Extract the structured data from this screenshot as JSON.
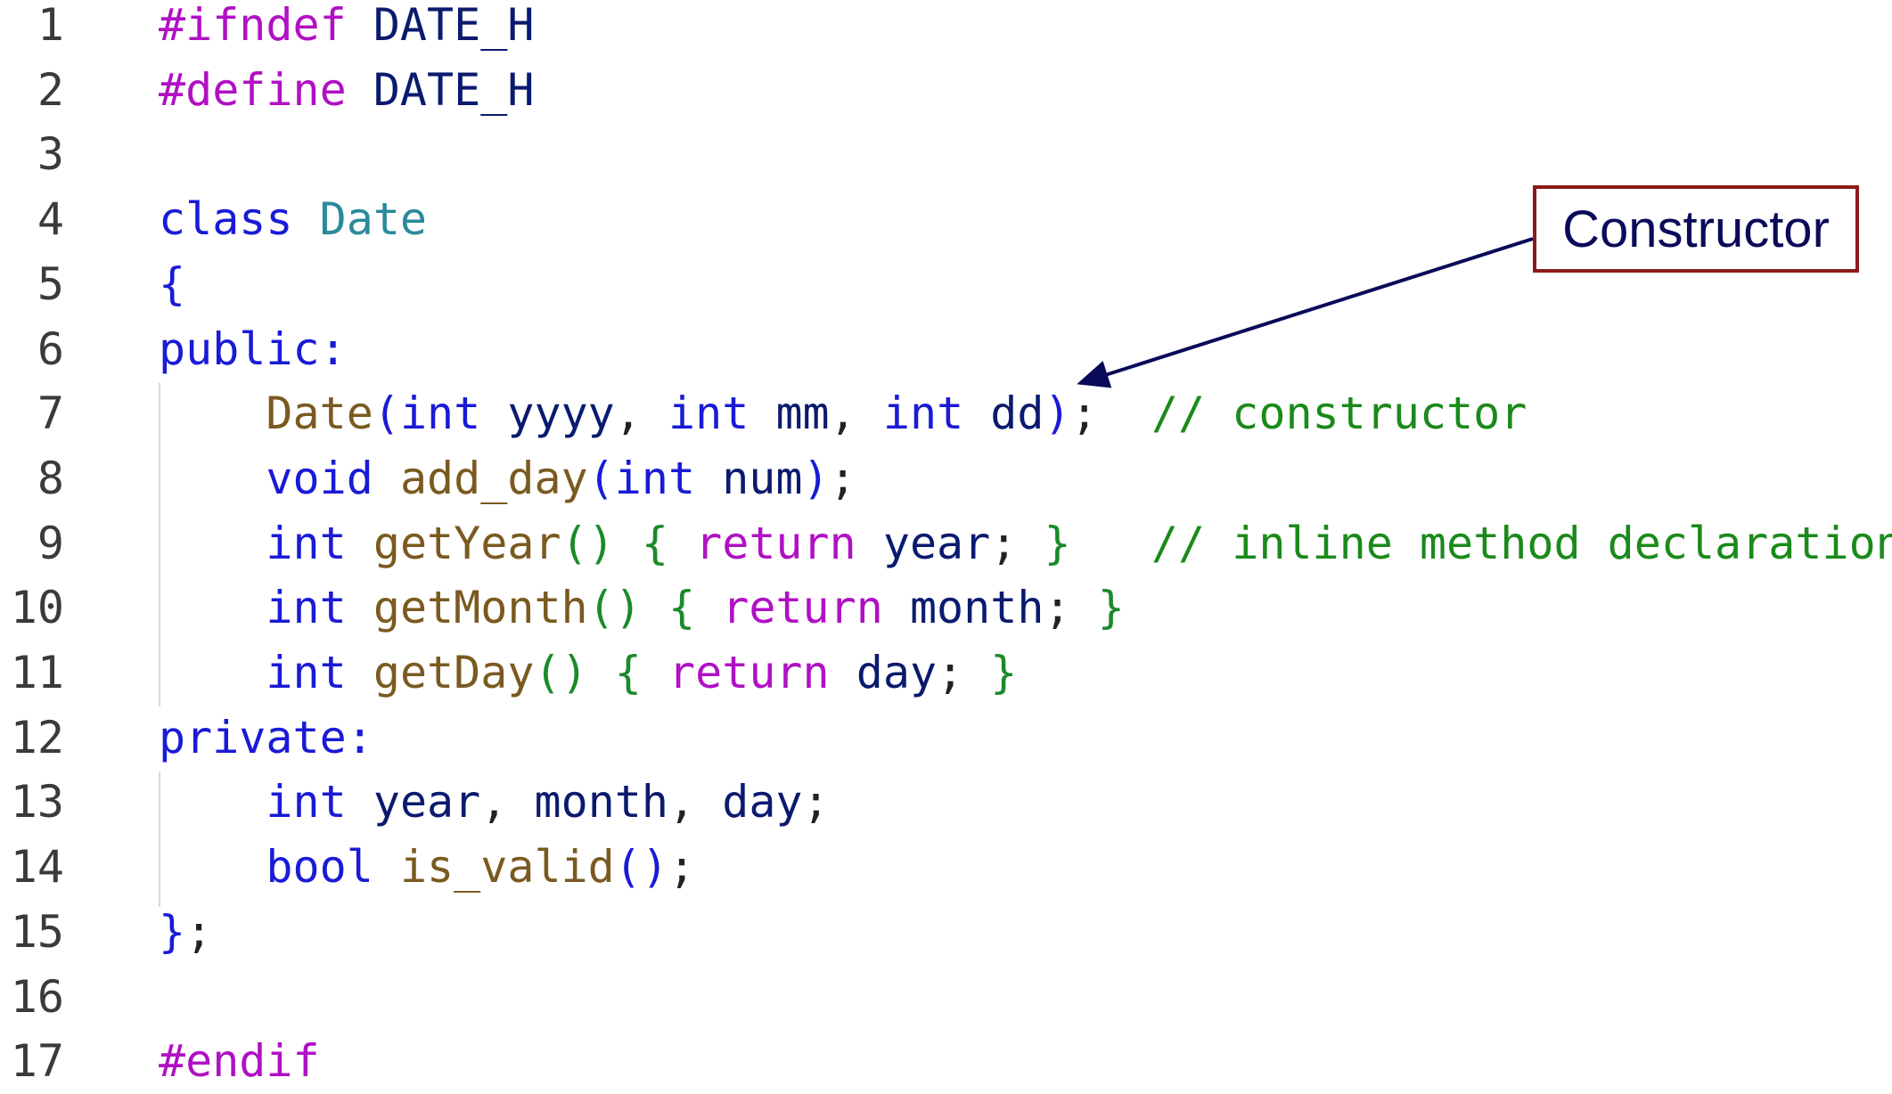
{
  "code": {
    "lines": [
      {
        "num": "1",
        "tokens": [
          {
            "t": "#ifndef",
            "c": "kw-purple"
          },
          {
            "t": " ",
            "c": "punct"
          },
          {
            "t": "DATE_H",
            "c": "var"
          }
        ]
      },
      {
        "num": "2",
        "tokens": [
          {
            "t": "#define",
            "c": "kw-purple"
          },
          {
            "t": " ",
            "c": "punct"
          },
          {
            "t": "DATE_H",
            "c": "var"
          }
        ]
      },
      {
        "num": "3",
        "tokens": []
      },
      {
        "num": "4",
        "tokens": [
          {
            "t": "class",
            "c": "kw-blue"
          },
          {
            "t": " ",
            "c": "punct"
          },
          {
            "t": "Date",
            "c": "type"
          }
        ]
      },
      {
        "num": "5",
        "tokens": [
          {
            "t": "{",
            "c": "brace-blue"
          }
        ]
      },
      {
        "num": "6",
        "tokens": [
          {
            "t": "public:",
            "c": "kw-blue"
          }
        ]
      },
      {
        "num": "7",
        "tokens": [
          {
            "t": "    ",
            "c": "punct"
          },
          {
            "t": "Date",
            "c": "fn"
          },
          {
            "t": "(",
            "c": "brace-blue"
          },
          {
            "t": "int",
            "c": "kw-blue"
          },
          {
            "t": " ",
            "c": "punct"
          },
          {
            "t": "yyyy",
            "c": "var"
          },
          {
            "t": ", ",
            "c": "punct"
          },
          {
            "t": "int",
            "c": "kw-blue"
          },
          {
            "t": " ",
            "c": "punct"
          },
          {
            "t": "mm",
            "c": "var"
          },
          {
            "t": ", ",
            "c": "punct"
          },
          {
            "t": "int",
            "c": "kw-blue"
          },
          {
            "t": " ",
            "c": "punct"
          },
          {
            "t": "dd",
            "c": "var"
          },
          {
            "t": ")",
            "c": "brace-blue"
          },
          {
            "t": ";  ",
            "c": "punct"
          },
          {
            "t": "// constructor",
            "c": "comment"
          }
        ]
      },
      {
        "num": "8",
        "tokens": [
          {
            "t": "    ",
            "c": "punct"
          },
          {
            "t": "void",
            "c": "kw-blue"
          },
          {
            "t": " ",
            "c": "punct"
          },
          {
            "t": "add_day",
            "c": "fn"
          },
          {
            "t": "(",
            "c": "brace-blue"
          },
          {
            "t": "int",
            "c": "kw-blue"
          },
          {
            "t": " ",
            "c": "punct"
          },
          {
            "t": "num",
            "c": "var"
          },
          {
            "t": ")",
            "c": "brace-blue"
          },
          {
            "t": ";",
            "c": "punct"
          }
        ]
      },
      {
        "num": "9",
        "tokens": [
          {
            "t": "    ",
            "c": "punct"
          },
          {
            "t": "int",
            "c": "kw-blue"
          },
          {
            "t": " ",
            "c": "punct"
          },
          {
            "t": "getYear",
            "c": "fn"
          },
          {
            "t": "()",
            "c": "brace"
          },
          {
            "t": " ",
            "c": "punct"
          },
          {
            "t": "{",
            "c": "brace"
          },
          {
            "t": " ",
            "c": "punct"
          },
          {
            "t": "return",
            "c": "kw-purple"
          },
          {
            "t": " ",
            "c": "punct"
          },
          {
            "t": "year",
            "c": "var"
          },
          {
            "t": "; ",
            "c": "punct"
          },
          {
            "t": "}",
            "c": "brace"
          },
          {
            "t": "   ",
            "c": "punct"
          },
          {
            "t": "// inline method declarations",
            "c": "comment"
          }
        ]
      },
      {
        "num": "10",
        "tokens": [
          {
            "t": "    ",
            "c": "punct"
          },
          {
            "t": "int",
            "c": "kw-blue"
          },
          {
            "t": " ",
            "c": "punct"
          },
          {
            "t": "getMonth",
            "c": "fn"
          },
          {
            "t": "()",
            "c": "brace"
          },
          {
            "t": " ",
            "c": "punct"
          },
          {
            "t": "{",
            "c": "brace"
          },
          {
            "t": " ",
            "c": "punct"
          },
          {
            "t": "return",
            "c": "kw-purple"
          },
          {
            "t": " ",
            "c": "punct"
          },
          {
            "t": "month",
            "c": "var"
          },
          {
            "t": "; ",
            "c": "punct"
          },
          {
            "t": "}",
            "c": "brace"
          }
        ]
      },
      {
        "num": "11",
        "tokens": [
          {
            "t": "    ",
            "c": "punct"
          },
          {
            "t": "int",
            "c": "kw-blue"
          },
          {
            "t": " ",
            "c": "punct"
          },
          {
            "t": "getDay",
            "c": "fn"
          },
          {
            "t": "()",
            "c": "brace"
          },
          {
            "t": " ",
            "c": "punct"
          },
          {
            "t": "{",
            "c": "brace"
          },
          {
            "t": " ",
            "c": "punct"
          },
          {
            "t": "return",
            "c": "kw-purple"
          },
          {
            "t": " ",
            "c": "punct"
          },
          {
            "t": "day",
            "c": "var"
          },
          {
            "t": "; ",
            "c": "punct"
          },
          {
            "t": "}",
            "c": "brace"
          }
        ]
      },
      {
        "num": "12",
        "tokens": [
          {
            "t": "private:",
            "c": "kw-blue"
          }
        ]
      },
      {
        "num": "13",
        "tokens": [
          {
            "t": "    ",
            "c": "punct"
          },
          {
            "t": "int",
            "c": "kw-blue"
          },
          {
            "t": " ",
            "c": "punct"
          },
          {
            "t": "year",
            "c": "var"
          },
          {
            "t": ", ",
            "c": "punct"
          },
          {
            "t": "month",
            "c": "var"
          },
          {
            "t": ", ",
            "c": "punct"
          },
          {
            "t": "day",
            "c": "var"
          },
          {
            "t": ";",
            "c": "punct"
          }
        ]
      },
      {
        "num": "14",
        "tokens": [
          {
            "t": "    ",
            "c": "punct"
          },
          {
            "t": "bool",
            "c": "kw-blue"
          },
          {
            "t": " ",
            "c": "punct"
          },
          {
            "t": "is_valid",
            "c": "fn"
          },
          {
            "t": "()",
            "c": "brace-blue"
          },
          {
            "t": ";",
            "c": "punct"
          }
        ]
      },
      {
        "num": "15",
        "tokens": [
          {
            "t": "}",
            "c": "brace-blue"
          },
          {
            "t": ";",
            "c": "punct"
          }
        ]
      },
      {
        "num": "16",
        "tokens": []
      },
      {
        "num": "17",
        "tokens": [
          {
            "t": "#endif",
            "c": "kw-purple"
          }
        ]
      }
    ]
  },
  "callout": {
    "label": "Constructor"
  },
  "colors": {
    "callout_border": "#8b1a1a",
    "arrow": "#0a0a5a"
  }
}
